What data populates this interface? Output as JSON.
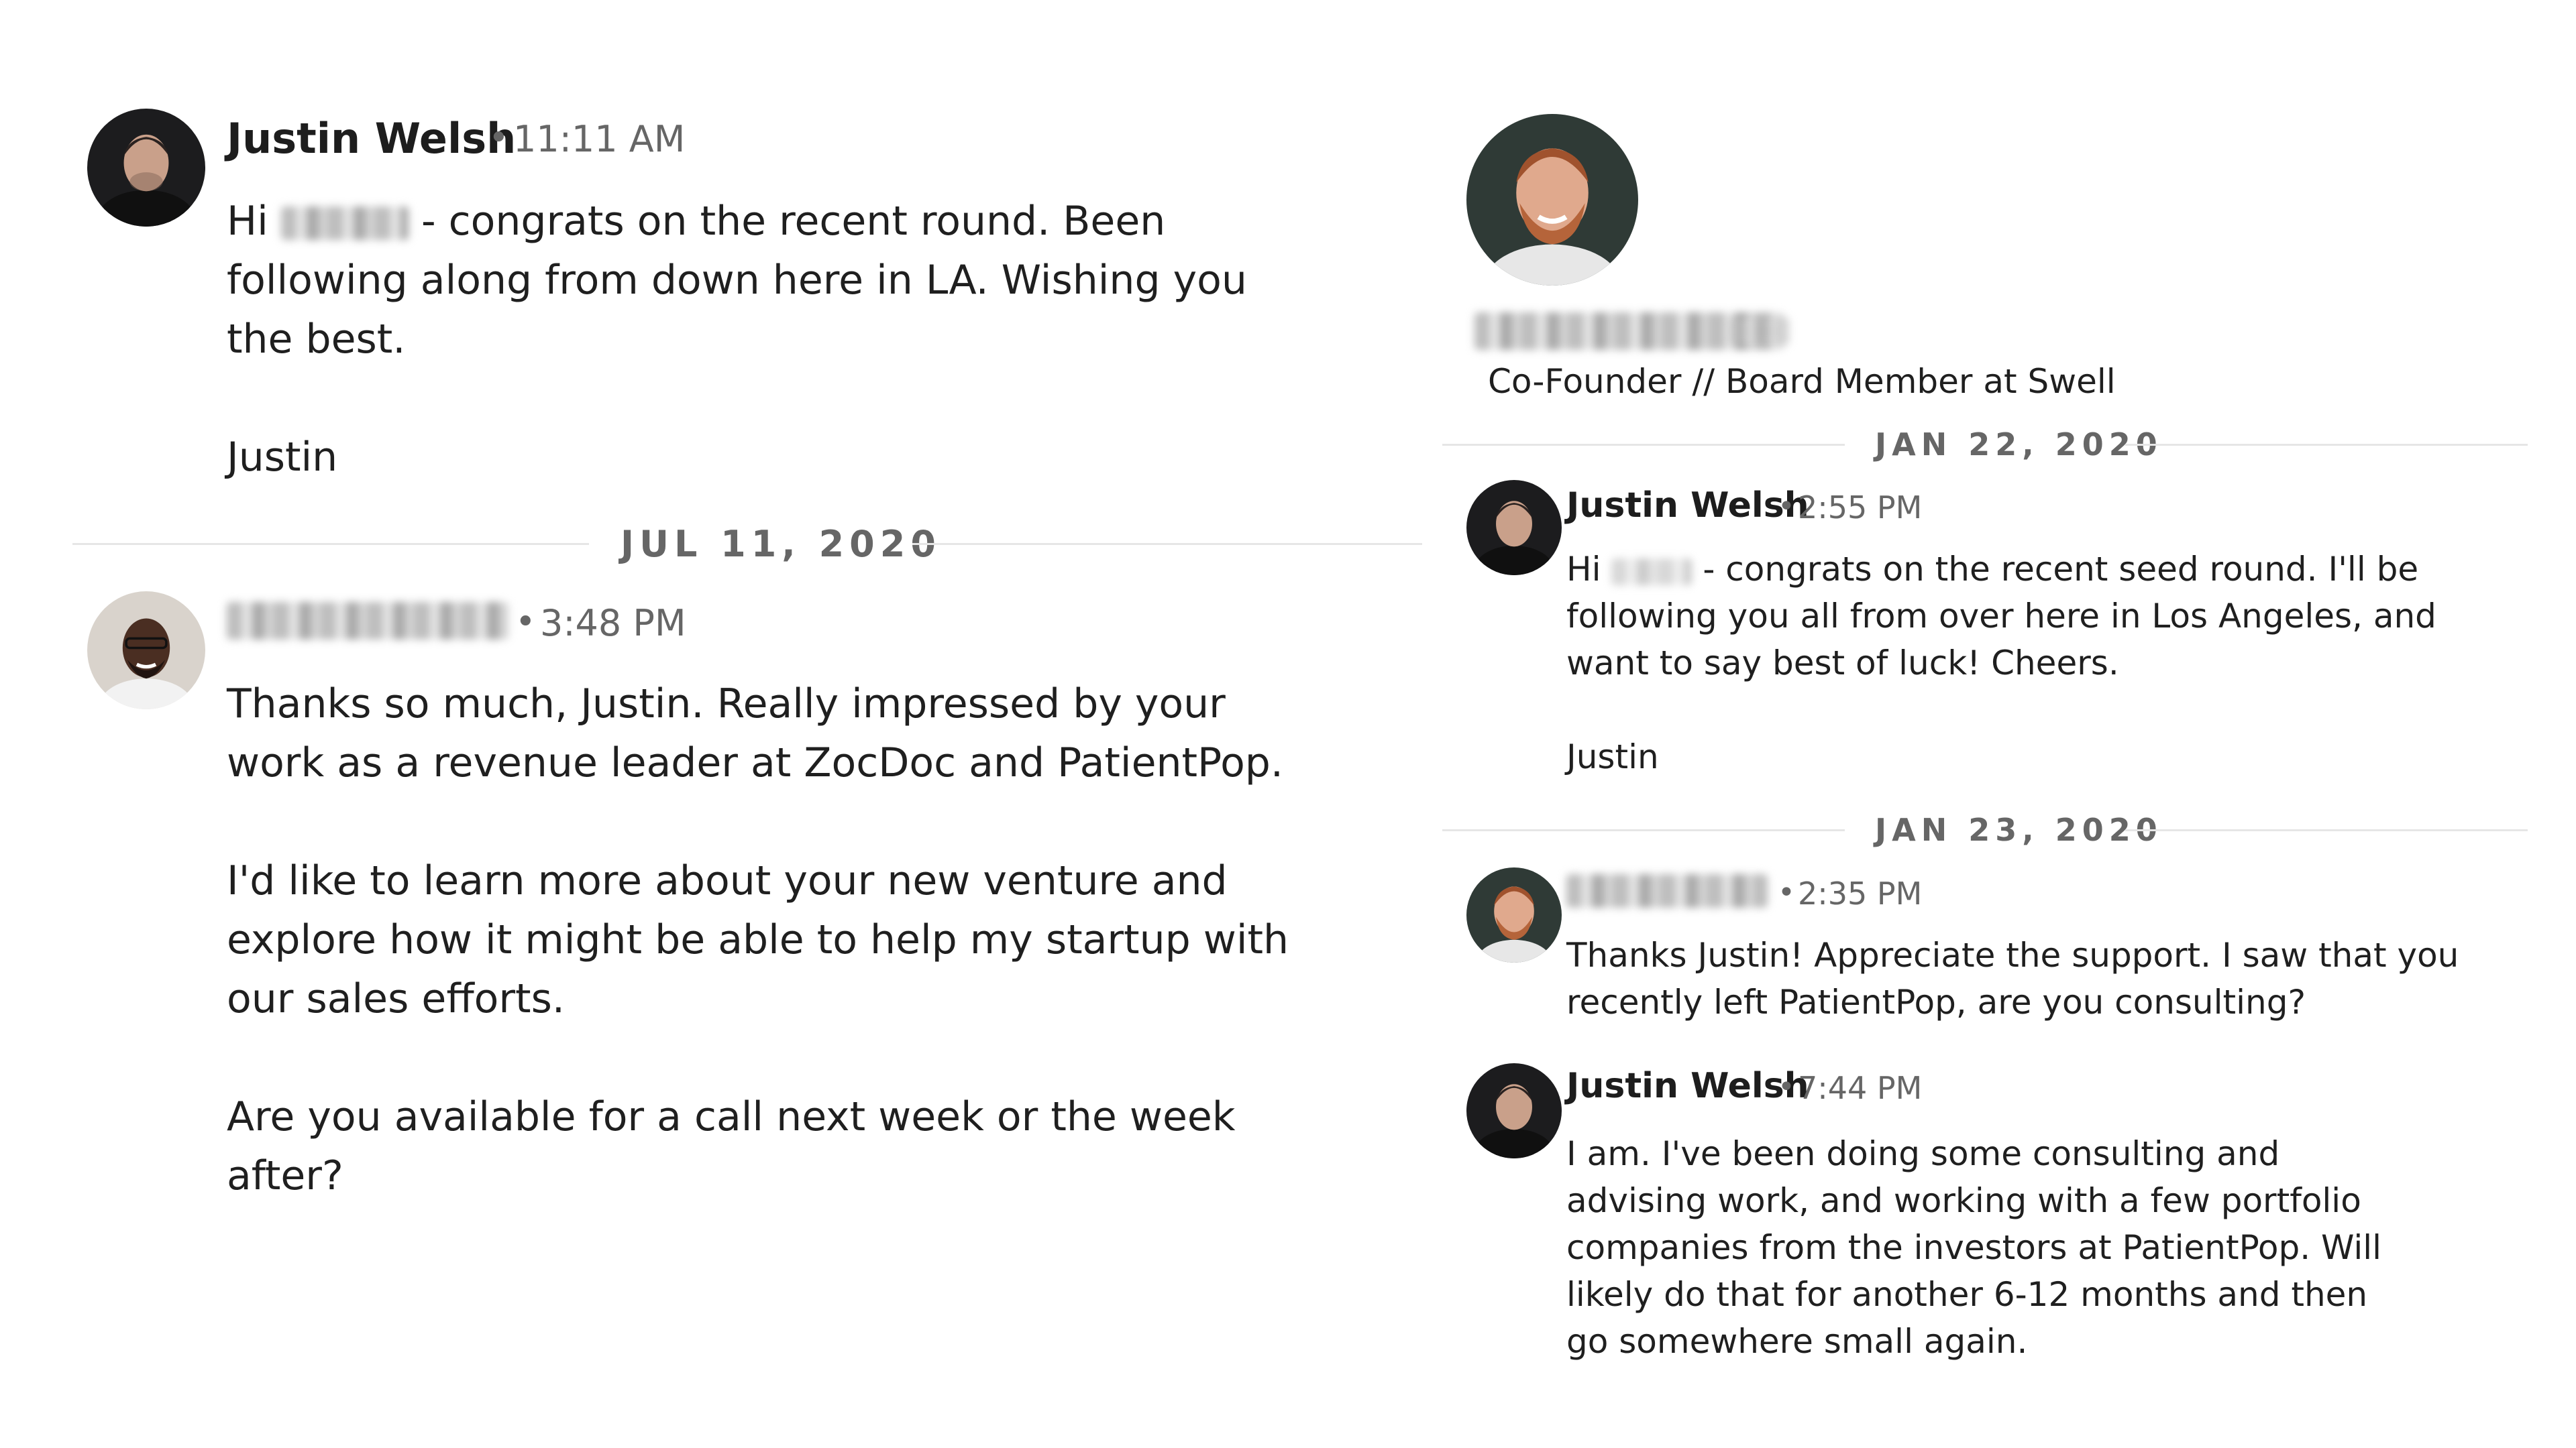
{
  "left_panel": {
    "message1": {
      "sender": "Justin Welsh",
      "separator": "•",
      "time": "11:11 AM",
      "text_prefix": "Hi",
      "text": "- congrats on the recent round. Been following along from down here in LA. Wishing you the best.",
      "signoff": "Justin"
    },
    "date_divider": "JUL 11, 2020",
    "message2": {
      "separator": "•",
      "time": "3:48 PM",
      "para1": "Thanks so much, Justin. Really impressed by your work as a revenue leader at ZocDoc and PatientPop.",
      "para2": "I'd like to learn more about your new venture and explore how it might be able to help my startup with our sales efforts.",
      "para3": "Are you available for a call next week or the week after?"
    }
  },
  "right_panel": {
    "profile": {
      "headline": "Co-Founder // Board Member at Swell"
    },
    "date_divider1": "JAN 22, 2020",
    "message1": {
      "sender": "Justin Welsh",
      "separator": "•",
      "time": "2:55 PM",
      "text_prefix": "Hi",
      "text": "- congrats on the recent seed round. I'll be following you all from over here in Los Angeles, and want to say best of luck! Cheers.",
      "signoff": "Justin"
    },
    "date_divider2": "JAN 23, 2020",
    "message2": {
      "separator": "•",
      "time": "2:35 PM",
      "text": "Thanks Justin! Appreciate the support. I saw that you recently left PatientPop, are you consulting?"
    },
    "message3": {
      "sender": "Justin Welsh",
      "separator": "•",
      "time": "7:44 PM",
      "text": "I am. I've been doing some consulting and advising work, and working with a few portfolio companies from the investors at PatientPop. Will likely do that for another 6-12 months and then go somewhere small again."
    }
  }
}
